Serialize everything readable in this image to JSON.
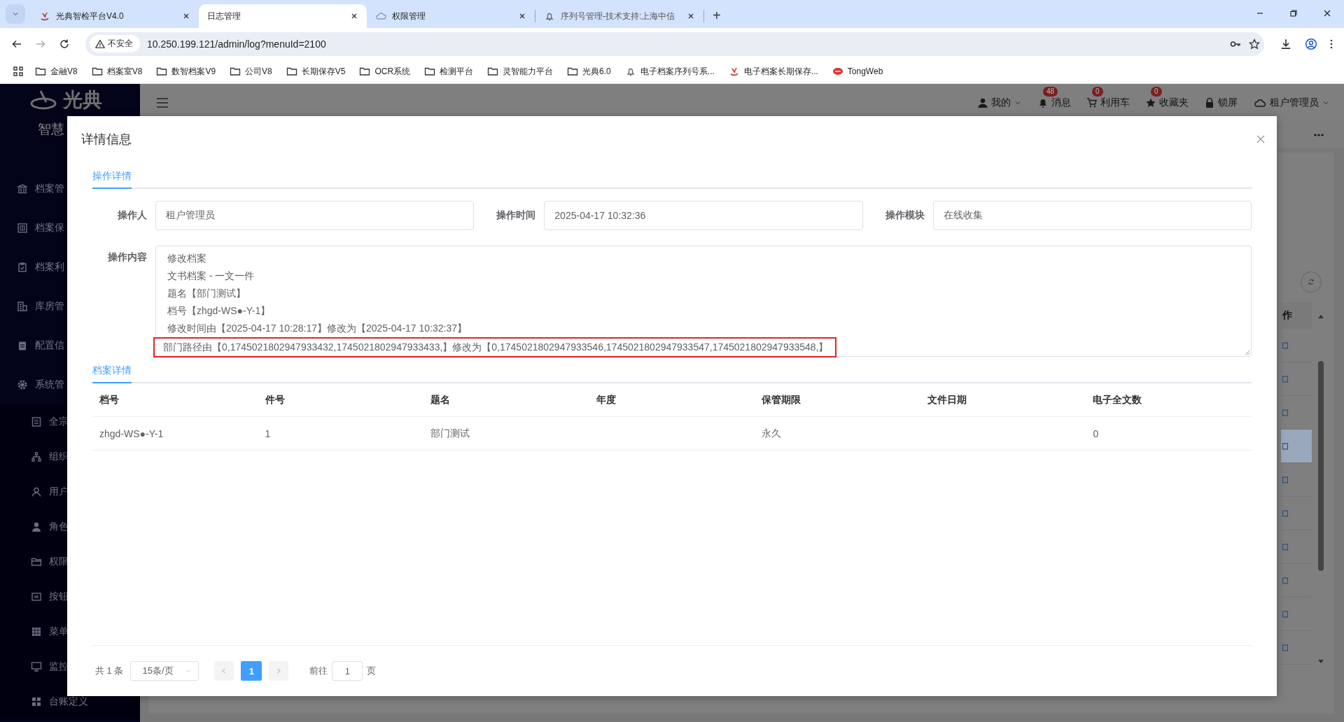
{
  "browser": {
    "tabs": [
      {
        "title": "光典智检平台V4.0",
        "selected": false
      },
      {
        "title": "日志管理",
        "selected": true
      },
      {
        "title": "权限管理",
        "selected": false
      },
      {
        "title": "序列号管理-技术支持:上海中信",
        "selected": false
      }
    ],
    "new_tab": "+",
    "security_label": "不安全",
    "url": "10.250.199.121/admin/log?menuId=2100",
    "bookmarks": [
      {
        "label": "金融V8",
        "kind": "folder"
      },
      {
        "label": "档案室V8",
        "kind": "folder"
      },
      {
        "label": "数智档案V9",
        "kind": "folder"
      },
      {
        "label": "公司V8",
        "kind": "folder"
      },
      {
        "label": "长期保存V5",
        "kind": "folder"
      },
      {
        "label": "OCR系统",
        "kind": "folder"
      },
      {
        "label": "检测平台",
        "kind": "folder"
      },
      {
        "label": "灵智能力平台",
        "kind": "folder"
      },
      {
        "label": "光典6.0",
        "kind": "folder"
      },
      {
        "label": "电子档案序列号系...",
        "kind": "link"
      },
      {
        "label": "电子档案长期保存...",
        "kind": "link"
      },
      {
        "label": "TongWeb",
        "kind": "link"
      }
    ]
  },
  "sidebar": {
    "logo_text": "光典",
    "subtitle": "智慧",
    "items": [
      {
        "label": "档案管"
      },
      {
        "label": "档案保"
      },
      {
        "label": "档案利"
      },
      {
        "label": "库房管"
      },
      {
        "label": "配置信"
      },
      {
        "label": "系统管",
        "children": [
          {
            "label": "全宗"
          },
          {
            "label": "组织"
          },
          {
            "label": "用户"
          },
          {
            "label": "角色"
          },
          {
            "label": "权限"
          },
          {
            "label": "按钮"
          },
          {
            "label": "菜单"
          },
          {
            "label": "监控"
          },
          {
            "label": "台账定义"
          }
        ]
      }
    ]
  },
  "header": {
    "items": [
      {
        "label": "我的",
        "dropdown": true
      },
      {
        "label": "消息",
        "badge": "48",
        "dropdown": false
      },
      {
        "label": "利用车",
        "badge": "0",
        "dropdown": false
      },
      {
        "label": "收藏夹",
        "badge": "0",
        "dropdown": false
      },
      {
        "label": "锁屏",
        "dropdown": false
      },
      {
        "label": "租户管理员",
        "dropdown": true
      }
    ]
  },
  "background_table": {
    "column_header": "作",
    "rows": [
      {
        "selected": false
      },
      {
        "selected": false
      },
      {
        "selected": false
      },
      {
        "selected": true
      },
      {
        "selected": false
      },
      {
        "selected": false
      },
      {
        "selected": false
      },
      {
        "selected": false
      },
      {
        "selected": false
      },
      {
        "selected": false
      }
    ]
  },
  "modal": {
    "title": "详情信息",
    "operation_tab": {
      "label": "操作详情",
      "selected": true
    },
    "fields": [
      {
        "label": "操作人",
        "value": "租户管理员"
      },
      {
        "label": "操作时间",
        "value": "2025-04-17 10:32:36"
      },
      {
        "label": "操作模块",
        "value": "在线收集"
      }
    ],
    "content": {
      "label": "操作内容",
      "lines": [
        {
          "text": "修改档案",
          "highlighted": false
        },
        {
          "text": "文书档案 - 一文一件",
          "highlighted": false
        },
        {
          "text": "题名【部门测试】",
          "highlighted": false
        },
        {
          "text": "档号【zhgd-WS●-Y-1】",
          "highlighted": false
        },
        {
          "text": "修改时间由【2025-04-17 10:28:17】修改为【2025-04-17 10:32:37】",
          "highlighted": false
        },
        {
          "text": "部门路径由【0,1745021802947933432,1745021802947933433,】修改为【0,1745021802947933546,1745021802947933547,1745021802947933548,】",
          "highlighted": true
        }
      ]
    },
    "archive_tab": {
      "label": "档案详情",
      "selected": true
    },
    "table": {
      "columns": [
        "档号",
        "件号",
        "题名",
        "年度",
        "保管期限",
        "文件日期",
        "电子全文数"
      ],
      "rows": [
        {
          "column_1": "zhgd-WS●-Y-1",
          "column_2": "1",
          "column_3": "部门测试",
          "column_5": "永久",
          "column_7": "0"
        }
      ]
    },
    "pagination": {
      "total": "共 1 条",
      "page_size": "15条/页",
      "prev_disabled": true,
      "next_disabled": true,
      "pages": [
        {
          "label": "1",
          "selected": true
        }
      ],
      "goto_label": "前往",
      "goto_value": "1",
      "goto_suffix": "页"
    }
  }
}
